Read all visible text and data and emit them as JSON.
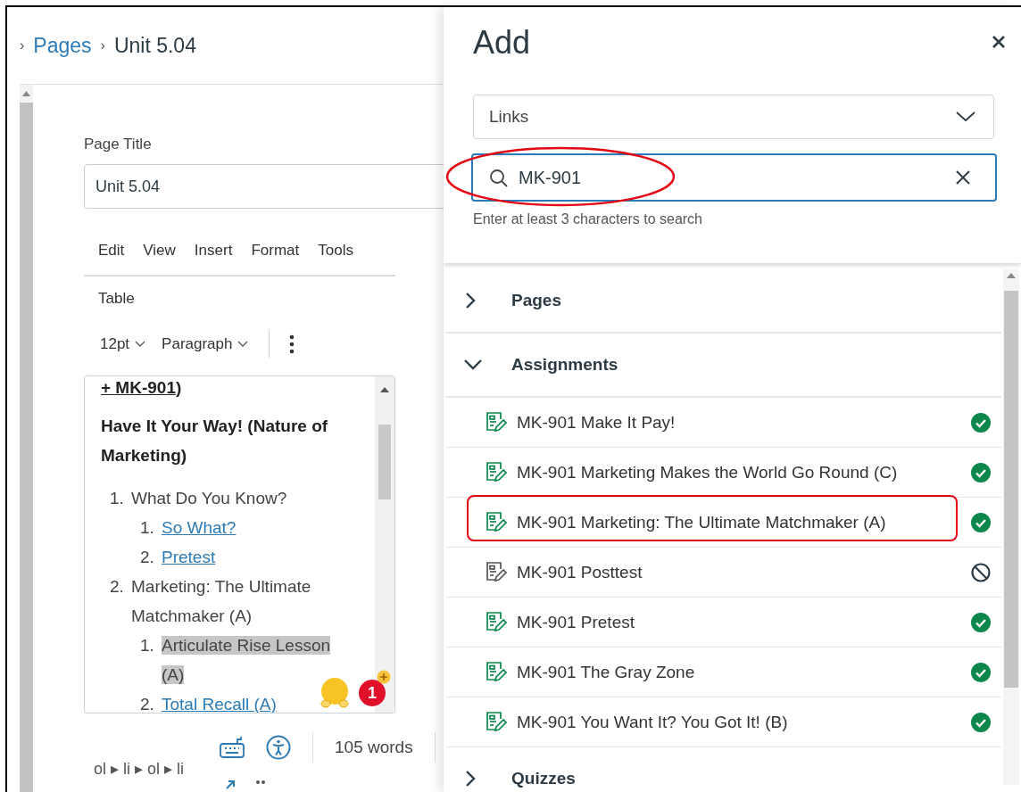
{
  "breadcrumb": {
    "separator": "›",
    "items": [
      {
        "label": "Pages",
        "link": true
      },
      {
        "label": "Unit 5.04",
        "link": false
      }
    ]
  },
  "page_title": {
    "label": "Page Title",
    "value": "Unit 5.04"
  },
  "menu": [
    "Edit",
    "View",
    "Insert",
    "Format",
    "Tools"
  ],
  "menu_row_2": [
    "Table"
  ],
  "toolbar": {
    "font_size": "12pt",
    "block_format": "Paragraph"
  },
  "editor": {
    "top_link": "+ MK-901",
    "top_rest": ")",
    "heading": "Have It Your Way! (Nature of Marketing)",
    "list": [
      {
        "number": "1.",
        "text": "What Do You Know?",
        "link": false,
        "selected": false,
        "children": [
          {
            "number": "1.",
            "text": "So What?",
            "link": true,
            "selected": false
          },
          {
            "number": "2.",
            "text": "Pretest",
            "link": true,
            "selected": false
          }
        ]
      },
      {
        "number": "2.",
        "text": "Marketing: The Ultimate Matchmaker (A)",
        "link": false,
        "selected": false,
        "children": [
          {
            "number": "1.",
            "text": "Articulate Rise Lesson (A)",
            "link": false,
            "selected": true
          },
          {
            "number": "2.",
            "text": "Total Recall (A)",
            "link": true,
            "selected": false
          }
        ]
      }
    ]
  },
  "notification_badge": {
    "count": "1"
  },
  "status_bar": {
    "word_count": "105 words",
    "element_path": "ol ▸ li ▸ ol ▸ li"
  },
  "tray": {
    "title": "Add",
    "content_type": "Links",
    "search": {
      "value": "MK-901",
      "circled": true
    },
    "hint": "Enter at least 3 characters to search",
    "groups": [
      {
        "label": "Pages",
        "expanded": false
      },
      {
        "label": "Assignments",
        "expanded": true,
        "items": [
          {
            "title": "MK-901 Make It Pay!",
            "kind": "published",
            "highlighted": false
          },
          {
            "title": "MK-901 Marketing Makes the World Go Round (C)",
            "kind": "published",
            "highlighted": false
          },
          {
            "title": "MK-901 Marketing: The Ultimate Matchmaker (A)",
            "kind": "published",
            "highlighted": true
          },
          {
            "title": "MK-901 Posttest",
            "kind": "unpublished",
            "highlighted": false
          },
          {
            "title": "MK-901 Pretest",
            "kind": "published",
            "highlighted": false
          },
          {
            "title": "MK-901 The Gray Zone",
            "kind": "published",
            "highlighted": false
          },
          {
            "title": "MK-901 You Want It? You Got It! (B)",
            "kind": "published",
            "highlighted": false
          }
        ]
      },
      {
        "label": "Quizzes",
        "expanded": false
      }
    ]
  }
}
